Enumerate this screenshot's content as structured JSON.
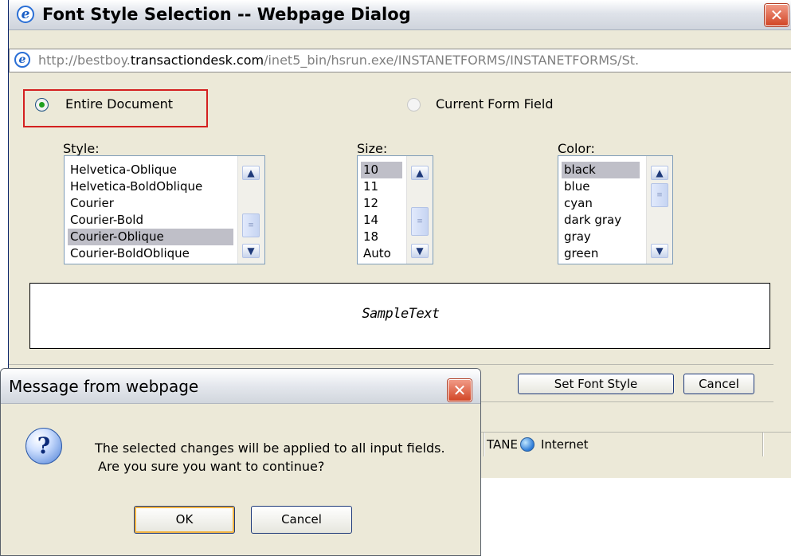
{
  "main_dialog": {
    "title": "Font Style Selection -- Webpage Dialog",
    "address": {
      "prefix": "http://bestboy.",
      "domain": "transactiondesk.com",
      "path": "/inet5_bin/hsrun.exe/INSTANETFORMS/INSTANETFORMS/St."
    },
    "scope": {
      "options": [
        "Entire Document",
        "Current Form Field"
      ],
      "selected": "Entire Document"
    },
    "style": {
      "label": "Style:",
      "items": [
        "Helvetica-Oblique",
        "Helvetica-BoldOblique",
        "Courier",
        "Courier-Bold",
        "Courier-Oblique",
        "Courier-BoldOblique"
      ],
      "selected": "Courier-Oblique"
    },
    "size": {
      "label": "Size:",
      "items": [
        "10",
        "11",
        "12",
        "14",
        "18",
        "Auto"
      ],
      "selected": "10"
    },
    "color": {
      "label": "Color:",
      "items": [
        "black",
        "blue",
        "cyan",
        "dark gray",
        "gray",
        "green"
      ],
      "selected": "black"
    },
    "sample_text": "SampleText",
    "buttons": {
      "set_font_style": "Set Font Style",
      "cancel": "Cancel"
    },
    "status": {
      "zone_fragment": "TANE",
      "zone": "Internet"
    }
  },
  "message_box": {
    "title": "Message from webpage",
    "line1": "The selected changes will be applied to all input fields.",
    "line2": "Are you sure you want to continue?",
    "ok_label": "OK",
    "cancel_label": "Cancel"
  },
  "icons": {
    "ie": "ie-icon",
    "close": "close-icon",
    "question": "question-icon",
    "globe": "globe-icon"
  },
  "colors": {
    "highlight_border": "#d42020",
    "selection": "#bfbfc8",
    "dialog_bg": "#ece9d8",
    "button_border": "#1f3a7a"
  }
}
